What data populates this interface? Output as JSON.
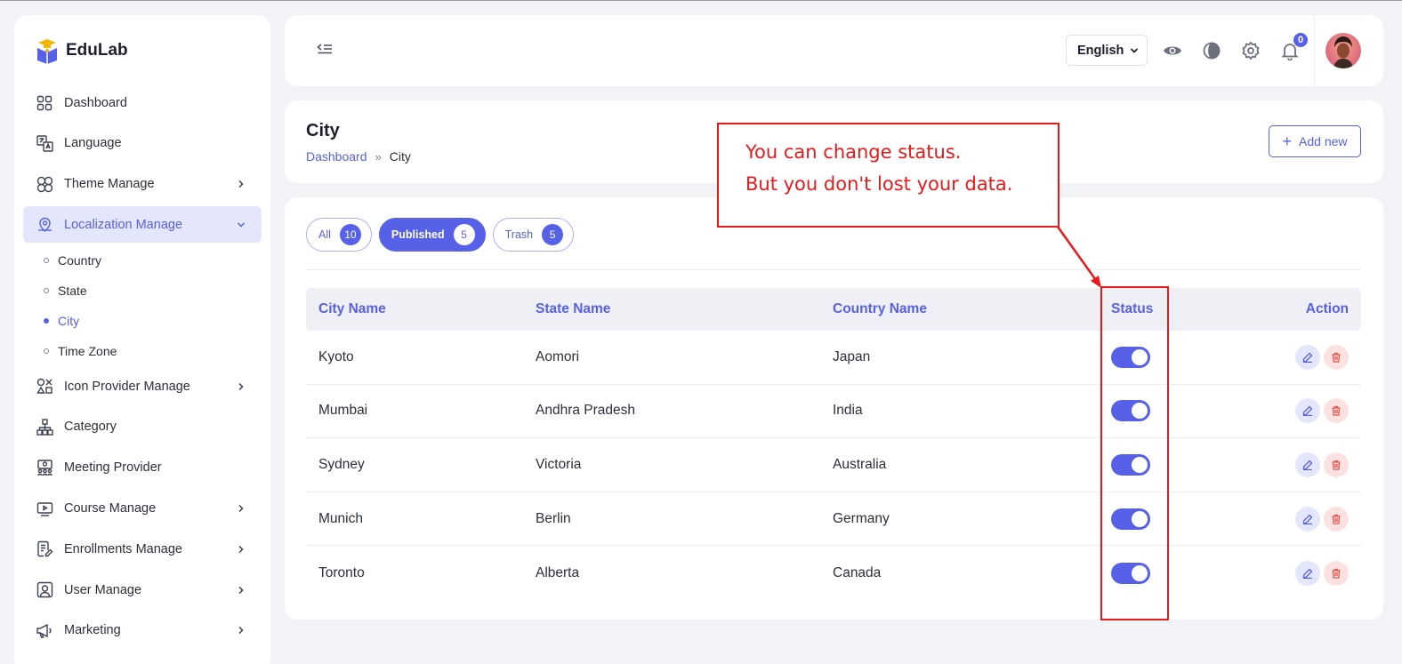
{
  "app": {
    "name": "EduLab"
  },
  "sidebar": {
    "items": [
      {
        "label": "Dashboard",
        "icon": "dashboard-icon",
        "has_children": false
      },
      {
        "label": "Language",
        "icon": "translate-icon",
        "has_children": false
      },
      {
        "label": "Theme Manage",
        "icon": "theme-icon",
        "has_children": true
      },
      {
        "label": "Localization Manage",
        "icon": "location-icon",
        "has_children": true,
        "expanded": true,
        "children": [
          {
            "label": "Country",
            "active": false
          },
          {
            "label": "State",
            "active": false
          },
          {
            "label": "City",
            "active": true
          },
          {
            "label": "Time Zone",
            "active": false
          }
        ]
      },
      {
        "label": "Icon Provider Manage",
        "icon": "shapes-icon",
        "has_children": true
      },
      {
        "label": "Category",
        "icon": "hierarchy-icon",
        "has_children": false
      },
      {
        "label": "Meeting Provider",
        "icon": "meeting-icon",
        "has_children": false
      },
      {
        "label": "Course Manage",
        "icon": "video-icon",
        "has_children": true
      },
      {
        "label": "Enrollments Manage",
        "icon": "document-edit-icon",
        "has_children": true
      },
      {
        "label": "User Manage",
        "icon": "user-square-icon",
        "has_children": true
      },
      {
        "label": "Marketing",
        "icon": "megaphone-icon",
        "has_children": true
      }
    ]
  },
  "header": {
    "language": "English",
    "notification_count": "0"
  },
  "page": {
    "title": "City",
    "breadcrumb": {
      "root": "Dashboard",
      "separator": "»",
      "current": "City"
    },
    "add_button": "Add new"
  },
  "filters": [
    {
      "label": "All",
      "count": "10",
      "active": false
    },
    {
      "label": "Published",
      "count": "5",
      "active": true
    },
    {
      "label": "Trash",
      "count": "5",
      "active": false
    }
  ],
  "table": {
    "columns": {
      "city": "City Name",
      "state": "State Name",
      "country": "Country Name",
      "status": "Status",
      "action": "Action"
    },
    "rows": [
      {
        "city": "Kyoto",
        "state": "Aomori",
        "country": "Japan",
        "status": true
      },
      {
        "city": "Mumbai",
        "state": "Andhra Pradesh",
        "country": "India",
        "status": true
      },
      {
        "city": "Sydney",
        "state": "Victoria",
        "country": "Australia",
        "status": true
      },
      {
        "city": "Munich",
        "state": "Berlin",
        "country": "Germany",
        "status": true
      },
      {
        "city": "Toronto",
        "state": "Alberta",
        "country": "Canada",
        "status": true
      }
    ]
  },
  "annotation": {
    "line1": "You can change status.",
    "line2": "But you don't lost your data."
  },
  "colors": {
    "accent": "#5661e8",
    "danger": "#e5534b",
    "annotation": "#e8181b"
  }
}
